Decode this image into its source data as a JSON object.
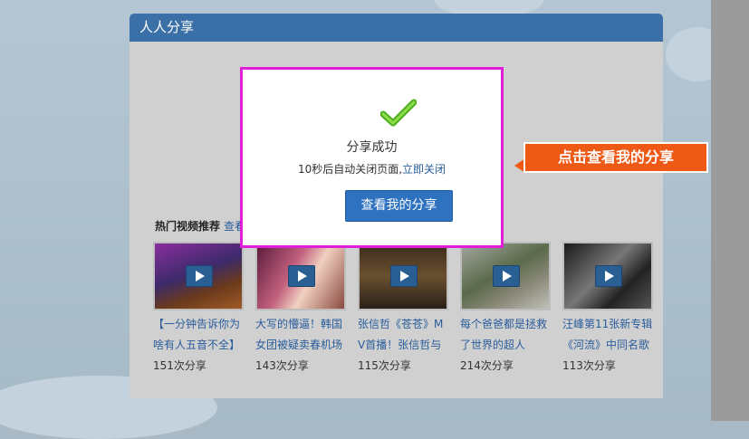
{
  "panel": {
    "title": "人人分享"
  },
  "modal": {
    "success_text": "分享成功",
    "countdown_text": "10秒后自动关闭页面,",
    "close_link": "立即关闭",
    "view_button": "查看我的分享"
  },
  "callout": {
    "text": "点击查看我的分享"
  },
  "videos": {
    "heading": "热门视频推荐",
    "more_link": "查看更多",
    "items": [
      {
        "title": "【一分钟告诉你为啥有人五音不全】",
        "count": "151次分享"
      },
      {
        "title": "大写的懵逼！韩国女团被疑卖春机场",
        "count": "143次分享"
      },
      {
        "title": "张信哲《苍苍》MV首播！张信哲与父",
        "count": "115次分享"
      },
      {
        "title": "每个爸爸都是拯救了世界的超人",
        "count": "214次分享"
      },
      {
        "title": "汪峰第11张新专辑《河流》中同名歌",
        "count": "113次分享"
      }
    ]
  },
  "colors": {
    "header": "#3b6fa7",
    "button": "#2f72c0",
    "callout": "#ee5a15",
    "modal_border": "#e020d8",
    "link": "#2a5d9c"
  },
  "icons": {
    "success": "green-check-icon",
    "play": "play-icon"
  }
}
